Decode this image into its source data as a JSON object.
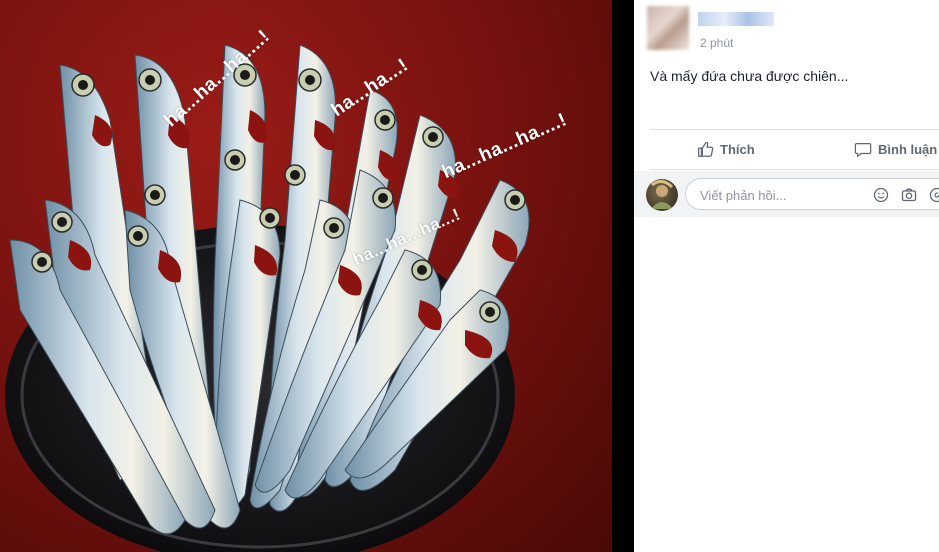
{
  "post": {
    "time": "2 phút",
    "text": "Và mấy đứa chưa được chiên...",
    "image_captions": [
      "ha...ha...ha....!",
      "ha...ha...!",
      "ha...ha...ha....!",
      "ha...ha...ha...!"
    ]
  },
  "actions": {
    "like_label": "Thích",
    "comment_label": "Bình luận"
  },
  "comment_box": {
    "placeholder": "Viết phản hồi..."
  },
  "icons": [
    "like-icon",
    "comment-icon",
    "emoji-icon",
    "camera-icon",
    "gif-icon"
  ]
}
